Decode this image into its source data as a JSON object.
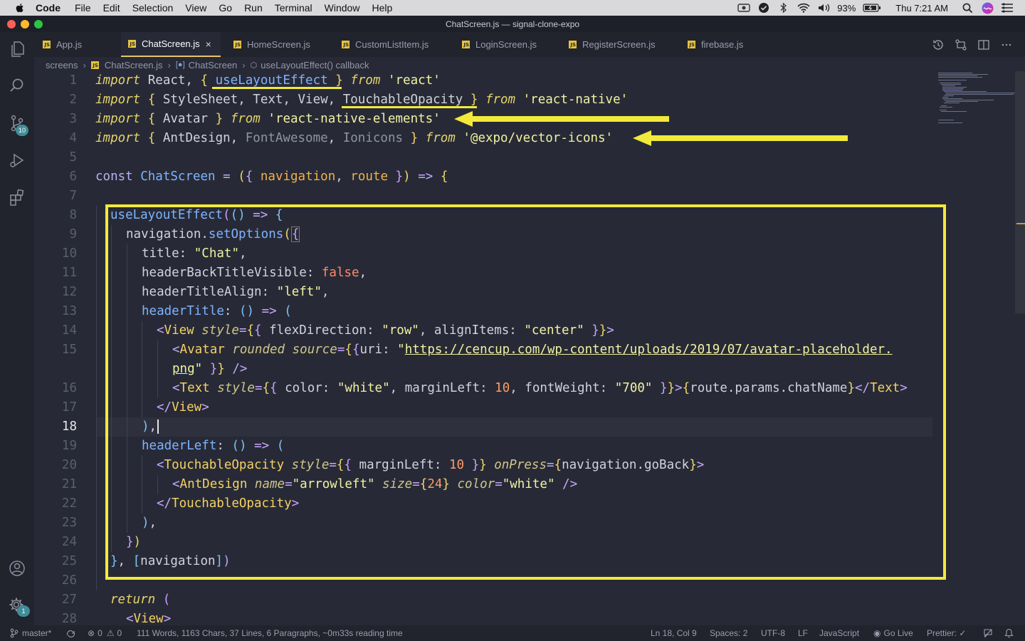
{
  "menubar": {
    "app": "Code",
    "items": [
      "File",
      "Edit",
      "Selection",
      "View",
      "Go",
      "Run",
      "Terminal",
      "Window",
      "Help"
    ],
    "battery": "93%",
    "clock": "Thu 7:21 AM"
  },
  "window": {
    "title": "ChatScreen.js — signal-clone-expo"
  },
  "activity": {
    "scm_badge": "10",
    "settings_badge": "1"
  },
  "tabs": [
    {
      "label": "App.js"
    },
    {
      "label": "ChatScreen.js",
      "active": true
    },
    {
      "label": "HomeScreen.js"
    },
    {
      "label": "CustomListItem.js"
    },
    {
      "label": "LoginScreen.js"
    },
    {
      "label": "RegisterScreen.js"
    },
    {
      "label": "firebase.js"
    }
  ],
  "breadcrumb": [
    "screens",
    "ChatScreen.js",
    "ChatScreen",
    "useLayoutEffect() callback"
  ],
  "line_numbers": [
    "1",
    "2",
    "3",
    "4",
    "5",
    "6",
    "7",
    "8",
    "9",
    "10",
    "11",
    "12",
    "13",
    "14",
    "15",
    "",
    "16",
    "17",
    "18",
    "19",
    "20",
    "21",
    "22",
    "23",
    "24",
    "25",
    "26",
    "27",
    "28"
  ],
  "current_line": "18",
  "statusbar": {
    "branch": "master*",
    "errors": "0",
    "warnings": "0",
    "wordcount": "111 Words, 1163 Chars, 37 Lines, 6 Paragraphs, ~0m33s reading time",
    "cursor": "Ln 18, Col 9",
    "spaces": "Spaces: 2",
    "encoding": "UTF-8",
    "eol": "LF",
    "language": "JavaScript",
    "golive": "Go Live",
    "prettier": "Prettier: ✓"
  },
  "colors": {
    "annotation": "#f2e93a",
    "accent": "#e8c36a"
  }
}
